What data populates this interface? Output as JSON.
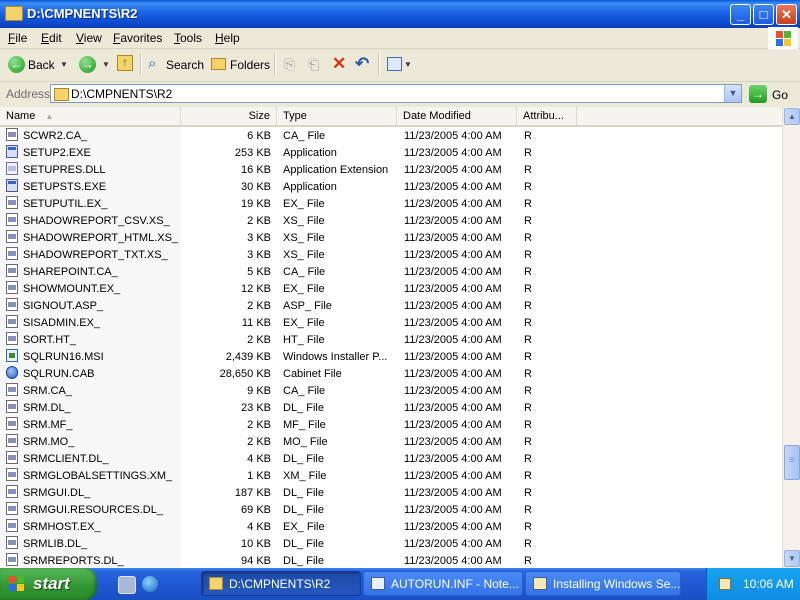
{
  "window": {
    "title": "D:\\CMPNENTS\\R2",
    "controls": {
      "minimize": "_",
      "maximize": "□",
      "close": "✕"
    }
  },
  "menu": [
    "File",
    "Edit",
    "View",
    "Favorites",
    "Tools",
    "Help"
  ],
  "toolbar": {
    "back_label": "Back",
    "search_label": "Search",
    "folders_label": "Folders"
  },
  "address": {
    "label": "Address",
    "value": "D:\\CMPNENTS\\R2",
    "go_label": "Go"
  },
  "columns": [
    "Name",
    "Size",
    "Type",
    "Date Modified",
    "Attribu..."
  ],
  "files": [
    {
      "name": "SCWR2.CA_",
      "size": "6 KB",
      "type": "CA_ File",
      "date": "11/23/2005 4:00 AM",
      "attr": "R",
      "icon": "generic"
    },
    {
      "name": "SETUP2.EXE",
      "size": "253 KB",
      "type": "Application",
      "date": "11/23/2005 4:00 AM",
      "attr": "R",
      "icon": "app"
    },
    {
      "name": "SETUPRES.DLL",
      "size": "16 KB",
      "type": "Application Extension",
      "date": "11/23/2005 4:00 AM",
      "attr": "R",
      "icon": "dll"
    },
    {
      "name": "SETUPSTS.EXE",
      "size": "30 KB",
      "type": "Application",
      "date": "11/23/2005 4:00 AM",
      "attr": "R",
      "icon": "app"
    },
    {
      "name": "SETUPUTIL.EX_",
      "size": "19 KB",
      "type": "EX_ File",
      "date": "11/23/2005 4:00 AM",
      "attr": "R",
      "icon": "generic"
    },
    {
      "name": "SHADOWREPORT_CSV.XS_",
      "size": "2 KB",
      "type": "XS_ File",
      "date": "11/23/2005 4:00 AM",
      "attr": "R",
      "icon": "generic"
    },
    {
      "name": "SHADOWREPORT_HTML.XS_",
      "size": "3 KB",
      "type": "XS_ File",
      "date": "11/23/2005 4:00 AM",
      "attr": "R",
      "icon": "generic"
    },
    {
      "name": "SHADOWREPORT_TXT.XS_",
      "size": "3 KB",
      "type": "XS_ File",
      "date": "11/23/2005 4:00 AM",
      "attr": "R",
      "icon": "generic"
    },
    {
      "name": "SHAREPOINT.CA_",
      "size": "5 KB",
      "type": "CA_ File",
      "date": "11/23/2005 4:00 AM",
      "attr": "R",
      "icon": "generic"
    },
    {
      "name": "SHOWMOUNT.EX_",
      "size": "12 KB",
      "type": "EX_ File",
      "date": "11/23/2005 4:00 AM",
      "attr": "R",
      "icon": "generic"
    },
    {
      "name": "SIGNOUT.ASP_",
      "size": "2 KB",
      "type": "ASP_ File",
      "date": "11/23/2005 4:00 AM",
      "attr": "R",
      "icon": "generic"
    },
    {
      "name": "SISADMIN.EX_",
      "size": "11 KB",
      "type": "EX_ File",
      "date": "11/23/2005 4:00 AM",
      "attr": "R",
      "icon": "generic"
    },
    {
      "name": "SORT.HT_",
      "size": "2 KB",
      "type": "HT_ File",
      "date": "11/23/2005 4:00 AM",
      "attr": "R",
      "icon": "generic"
    },
    {
      "name": "SQLRUN16.MSI",
      "size": "2,439 KB",
      "type": "Windows Installer P...",
      "date": "11/23/2005 4:00 AM",
      "attr": "R",
      "icon": "msi"
    },
    {
      "name": "SQLRUN.CAB",
      "size": "28,650 KB",
      "type": "Cabinet File",
      "date": "11/23/2005 4:00 AM",
      "attr": "R",
      "icon": "cab"
    },
    {
      "name": "SRM.CA_",
      "size": "9 KB",
      "type": "CA_ File",
      "date": "11/23/2005 4:00 AM",
      "attr": "R",
      "icon": "generic"
    },
    {
      "name": "SRM.DL_",
      "size": "23 KB",
      "type": "DL_ File",
      "date": "11/23/2005 4:00 AM",
      "attr": "R",
      "icon": "generic"
    },
    {
      "name": "SRM.MF_",
      "size": "2 KB",
      "type": "MF_ File",
      "date": "11/23/2005 4:00 AM",
      "attr": "R",
      "icon": "generic"
    },
    {
      "name": "SRM.MO_",
      "size": "2 KB",
      "type": "MO_ File",
      "date": "11/23/2005 4:00 AM",
      "attr": "R",
      "icon": "generic"
    },
    {
      "name": "SRMCLIENT.DL_",
      "size": "4 KB",
      "type": "DL_ File",
      "date": "11/23/2005 4:00 AM",
      "attr": "R",
      "icon": "generic"
    },
    {
      "name": "SRMGLOBALSETTINGS.XM_",
      "size": "1 KB",
      "type": "XM_ File",
      "date": "11/23/2005 4:00 AM",
      "attr": "R",
      "icon": "generic"
    },
    {
      "name": "SRMGUI.DL_",
      "size": "187 KB",
      "type": "DL_ File",
      "date": "11/23/2005 4:00 AM",
      "attr": "R",
      "icon": "generic"
    },
    {
      "name": "SRMGUI.RESOURCES.DL_",
      "size": "69 KB",
      "type": "DL_ File",
      "date": "11/23/2005 4:00 AM",
      "attr": "R",
      "icon": "generic"
    },
    {
      "name": "SRMHOST.EX_",
      "size": "4 KB",
      "type": "EX_ File",
      "date": "11/23/2005 4:00 AM",
      "attr": "R",
      "icon": "generic"
    },
    {
      "name": "SRMLIB.DL_",
      "size": "10 KB",
      "type": "DL_ File",
      "date": "11/23/2005 4:00 AM",
      "attr": "R",
      "icon": "generic"
    },
    {
      "name": "SRMREPORTS.DL_",
      "size": "94 KB",
      "type": "DL_ File",
      "date": "11/23/2005 4:00 AM",
      "attr": "R",
      "icon": "generic"
    }
  ],
  "scrollbar": {
    "position_fraction": 0.82
  },
  "taskbar": {
    "start_label": "start",
    "tasks": [
      {
        "label": "D:\\CMPNENTS\\R2",
        "active": true,
        "icon": "folder-icon"
      },
      {
        "label": "AUTORUN.INF - Note...",
        "active": false,
        "icon": "notepad-icon"
      },
      {
        "label": "Installing Windows Se...",
        "active": false,
        "icon": "setup-wizard-icon"
      }
    ],
    "clock": "10:06 AM"
  },
  "colors": {
    "titlebar": "#0a58d8",
    "taskbar": "#2059d4",
    "start": "#2f942f",
    "tray": "#0f8ce4"
  }
}
